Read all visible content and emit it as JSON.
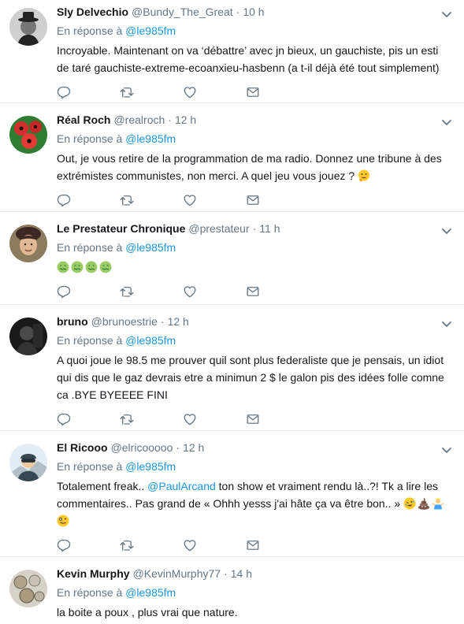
{
  "reply_prefix": "En réponse à",
  "tweets": [
    {
      "name": "Sly Delvechio",
      "handle": "@Bundy_The_Great",
      "time": "10 h",
      "reply_to": "@le985fm",
      "text": "Incroyable. Maintenant on va ‘débattre’ avec jn bieux, un gauchiste, pis un esti de taré gauchiste-extreme-ecoanxieu-hasbenn (a t-il déjà été tout simplement)"
    },
    {
      "name": "Réal Roch",
      "handle": "@realroch",
      "time": "12 h",
      "reply_to": "@le985fm",
      "text": "Out, je vous retire de la programmation de ma radio. Donnez une tribune à des extrémistes communistes, non merci. A quel jeu vous jouez ?",
      "trailing_emoji": [
        "thinking-face-emoji"
      ]
    },
    {
      "name": "Le Prestateur Chronique",
      "handle": "@prestateur",
      "time": "11 h",
      "reply_to": "@le985fm",
      "emojis": [
        "nauseated-face-emoji",
        "nauseated-face-emoji",
        "nauseated-face-emoji",
        "nauseated-face-emoji"
      ]
    },
    {
      "name": "bruno",
      "handle": "@brunoestrie",
      "time": "12 h",
      "reply_to": "@le985fm",
      "text": "A quoi joue le 98.5 me prouver quil sont plus federaliste que je pensais,  un idiot qui dis que le gaz devrais etre a minimun 2 $ le galon pis des idées folle comne ca .BYE BYEEEE  FINI"
    },
    {
      "name": "El Ricooo",
      "handle": "@elricooooo",
      "time": "12 h",
      "reply_to": "@le985fm",
      "text_before": "Totalement freak.. ",
      "mention": "@PaulArcand",
      "text_after": " ton show et vraiment rendu là..?! Tk a lire les commentaires.. Pas grand de « Ohhh yesss j'ai hâte ça va être bon.. » ",
      "trailing_emoji": [
        "rolling-laughing-emoji",
        "poo-emoji",
        "man-shrugging-emoji",
        "zany-face-emoji"
      ]
    },
    {
      "name": "Kevin Murphy",
      "handle": "@KevinMurphy77",
      "time": "14 h",
      "reply_to": "@le985fm",
      "text": "la boite a poux , plus vrai que nature."
    }
  ],
  "colors": {
    "link": "#1b95e0",
    "muted": "#657786",
    "text": "#14171a",
    "divider": "#e6ecf0"
  }
}
